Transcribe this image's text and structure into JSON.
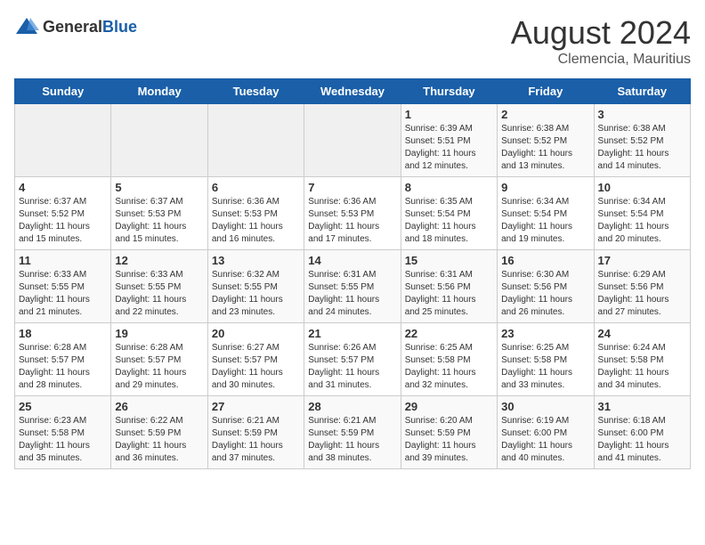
{
  "header": {
    "logo_general": "General",
    "logo_blue": "Blue",
    "month_year": "August 2024",
    "location": "Clemencia, Mauritius"
  },
  "weekdays": [
    "Sunday",
    "Monday",
    "Tuesday",
    "Wednesday",
    "Thursday",
    "Friday",
    "Saturday"
  ],
  "weeks": [
    [
      {
        "day": "",
        "info": ""
      },
      {
        "day": "",
        "info": ""
      },
      {
        "day": "",
        "info": ""
      },
      {
        "day": "",
        "info": ""
      },
      {
        "day": "1",
        "info": "Sunrise: 6:39 AM\nSunset: 5:51 PM\nDaylight: 11 hours\nand 12 minutes."
      },
      {
        "day": "2",
        "info": "Sunrise: 6:38 AM\nSunset: 5:52 PM\nDaylight: 11 hours\nand 13 minutes."
      },
      {
        "day": "3",
        "info": "Sunrise: 6:38 AM\nSunset: 5:52 PM\nDaylight: 11 hours\nand 14 minutes."
      }
    ],
    [
      {
        "day": "4",
        "info": "Sunrise: 6:37 AM\nSunset: 5:52 PM\nDaylight: 11 hours\nand 15 minutes."
      },
      {
        "day": "5",
        "info": "Sunrise: 6:37 AM\nSunset: 5:53 PM\nDaylight: 11 hours\nand 15 minutes."
      },
      {
        "day": "6",
        "info": "Sunrise: 6:36 AM\nSunset: 5:53 PM\nDaylight: 11 hours\nand 16 minutes."
      },
      {
        "day": "7",
        "info": "Sunrise: 6:36 AM\nSunset: 5:53 PM\nDaylight: 11 hours\nand 17 minutes."
      },
      {
        "day": "8",
        "info": "Sunrise: 6:35 AM\nSunset: 5:54 PM\nDaylight: 11 hours\nand 18 minutes."
      },
      {
        "day": "9",
        "info": "Sunrise: 6:34 AM\nSunset: 5:54 PM\nDaylight: 11 hours\nand 19 minutes."
      },
      {
        "day": "10",
        "info": "Sunrise: 6:34 AM\nSunset: 5:54 PM\nDaylight: 11 hours\nand 20 minutes."
      }
    ],
    [
      {
        "day": "11",
        "info": "Sunrise: 6:33 AM\nSunset: 5:55 PM\nDaylight: 11 hours\nand 21 minutes."
      },
      {
        "day": "12",
        "info": "Sunrise: 6:33 AM\nSunset: 5:55 PM\nDaylight: 11 hours\nand 22 minutes."
      },
      {
        "day": "13",
        "info": "Sunrise: 6:32 AM\nSunset: 5:55 PM\nDaylight: 11 hours\nand 23 minutes."
      },
      {
        "day": "14",
        "info": "Sunrise: 6:31 AM\nSunset: 5:55 PM\nDaylight: 11 hours\nand 24 minutes."
      },
      {
        "day": "15",
        "info": "Sunrise: 6:31 AM\nSunset: 5:56 PM\nDaylight: 11 hours\nand 25 minutes."
      },
      {
        "day": "16",
        "info": "Sunrise: 6:30 AM\nSunset: 5:56 PM\nDaylight: 11 hours\nand 26 minutes."
      },
      {
        "day": "17",
        "info": "Sunrise: 6:29 AM\nSunset: 5:56 PM\nDaylight: 11 hours\nand 27 minutes."
      }
    ],
    [
      {
        "day": "18",
        "info": "Sunrise: 6:28 AM\nSunset: 5:57 PM\nDaylight: 11 hours\nand 28 minutes."
      },
      {
        "day": "19",
        "info": "Sunrise: 6:28 AM\nSunset: 5:57 PM\nDaylight: 11 hours\nand 29 minutes."
      },
      {
        "day": "20",
        "info": "Sunrise: 6:27 AM\nSunset: 5:57 PM\nDaylight: 11 hours\nand 30 minutes."
      },
      {
        "day": "21",
        "info": "Sunrise: 6:26 AM\nSunset: 5:57 PM\nDaylight: 11 hours\nand 31 minutes."
      },
      {
        "day": "22",
        "info": "Sunrise: 6:25 AM\nSunset: 5:58 PM\nDaylight: 11 hours\nand 32 minutes."
      },
      {
        "day": "23",
        "info": "Sunrise: 6:25 AM\nSunset: 5:58 PM\nDaylight: 11 hours\nand 33 minutes."
      },
      {
        "day": "24",
        "info": "Sunrise: 6:24 AM\nSunset: 5:58 PM\nDaylight: 11 hours\nand 34 minutes."
      }
    ],
    [
      {
        "day": "25",
        "info": "Sunrise: 6:23 AM\nSunset: 5:58 PM\nDaylight: 11 hours\nand 35 minutes."
      },
      {
        "day": "26",
        "info": "Sunrise: 6:22 AM\nSunset: 5:59 PM\nDaylight: 11 hours\nand 36 minutes."
      },
      {
        "day": "27",
        "info": "Sunrise: 6:21 AM\nSunset: 5:59 PM\nDaylight: 11 hours\nand 37 minutes."
      },
      {
        "day": "28",
        "info": "Sunrise: 6:21 AM\nSunset: 5:59 PM\nDaylight: 11 hours\nand 38 minutes."
      },
      {
        "day": "29",
        "info": "Sunrise: 6:20 AM\nSunset: 5:59 PM\nDaylight: 11 hours\nand 39 minutes."
      },
      {
        "day": "30",
        "info": "Sunrise: 6:19 AM\nSunset: 6:00 PM\nDaylight: 11 hours\nand 40 minutes."
      },
      {
        "day": "31",
        "info": "Sunrise: 6:18 AM\nSunset: 6:00 PM\nDaylight: 11 hours\nand 41 minutes."
      }
    ]
  ]
}
